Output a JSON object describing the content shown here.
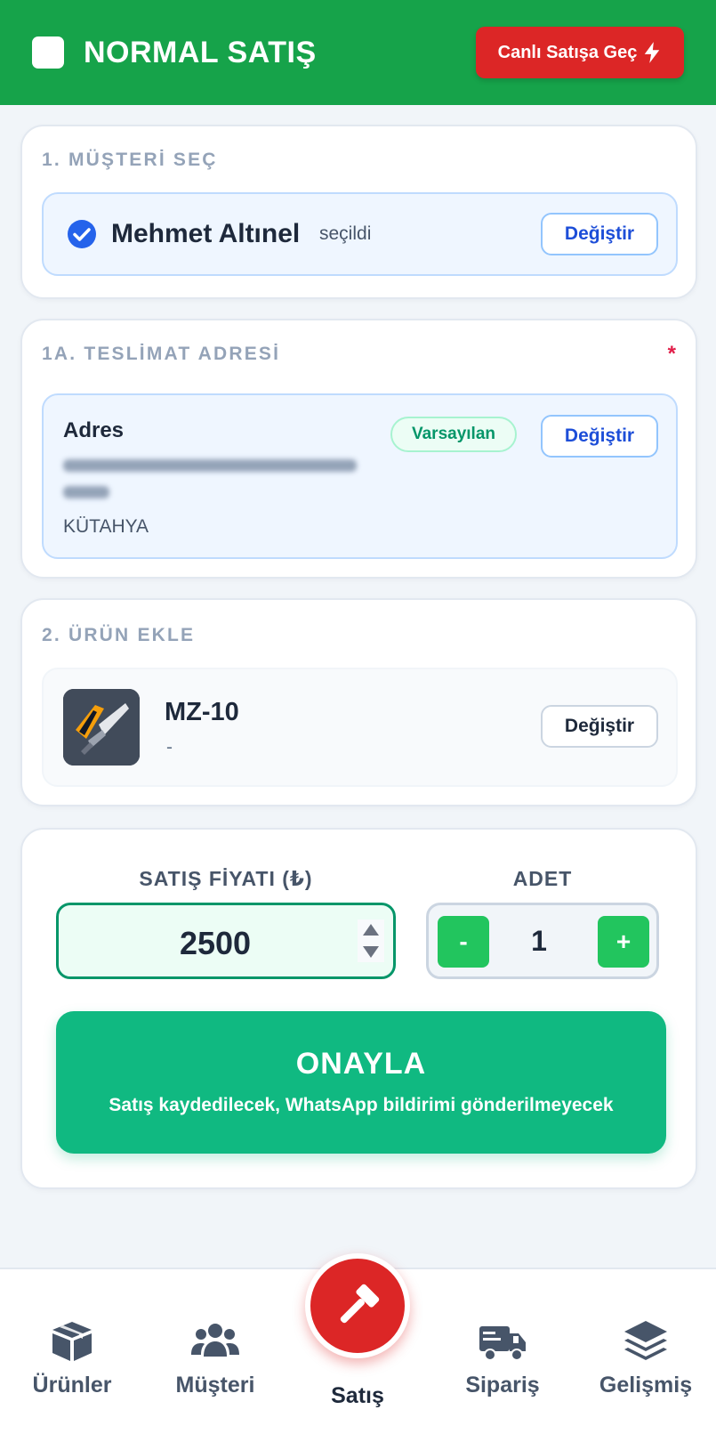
{
  "header": {
    "title": "NORMAL SATIŞ",
    "live_button": "Canlı Satışa Geç",
    "live_icon": "bolt-icon"
  },
  "customer": {
    "section_title": "1. MÜŞTERİ SEÇ",
    "name": "Mehmet Altınel",
    "status": "seçildi",
    "change_label": "Değiştir"
  },
  "address": {
    "section_title": "1A. TESLİMAT ADRESİ",
    "required_mark": "*",
    "title": "Adres",
    "default_badge": "Varsayılan",
    "change_label": "Değiştir",
    "city": "KÜTAHYA"
  },
  "product": {
    "section_title": "2. ÜRÜN EKLE",
    "name": "MZ-10",
    "subtitle": "-",
    "change_label": "Değiştir"
  },
  "sale": {
    "price_label": "SATIŞ FİYATI (₺)",
    "price_value": "2500",
    "qty_label": "ADET",
    "qty_minus": "-",
    "qty_value": "1",
    "qty_plus": "+",
    "confirm_title": "ONAYLA",
    "confirm_subtitle": "Satış kaydedilecek, WhatsApp bildirimi gönderilmeyecek"
  },
  "nav": {
    "items": [
      {
        "label": "Ürünler",
        "icon": "box-icon"
      },
      {
        "label": "Müşteri",
        "icon": "users-icon"
      },
      {
        "label": "Satış",
        "icon": "gavel-icon"
      },
      {
        "label": "Sipariş",
        "icon": "truck-icon"
      },
      {
        "label": "Gelişmiş",
        "icon": "layers-icon"
      }
    ]
  },
  "colors": {
    "header": "#16a34a",
    "live_button": "#dc2626",
    "confirm": "#10b981",
    "accent_blue": "#1d4ed8"
  }
}
